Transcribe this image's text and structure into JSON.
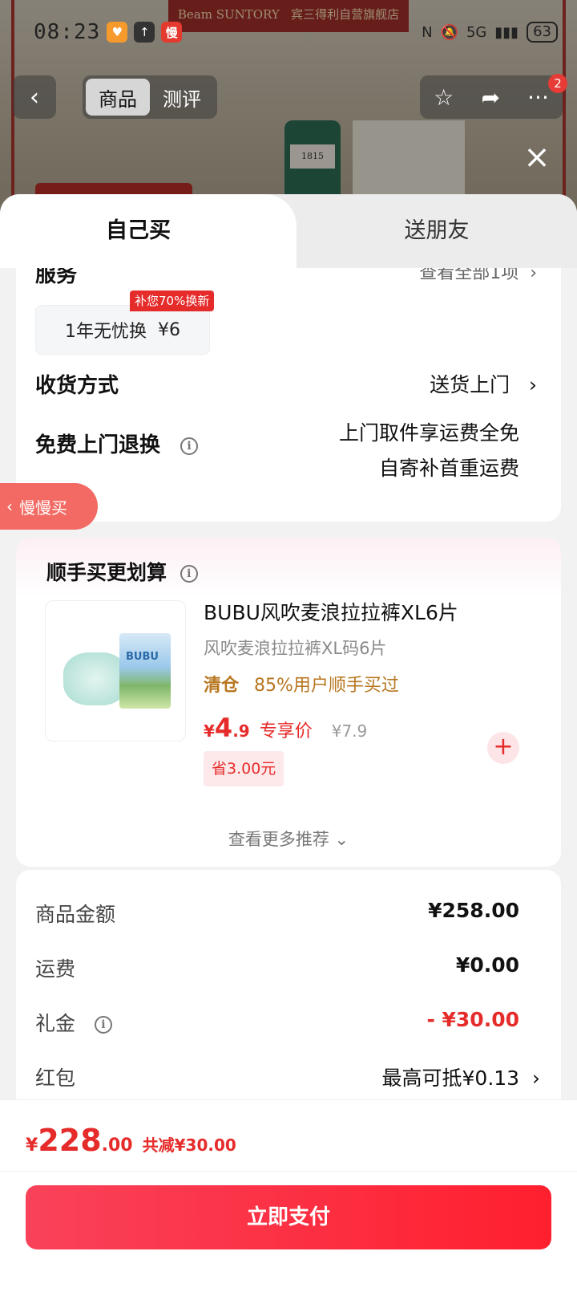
{
  "background": {
    "banner_brand": "Beam SUNTORY",
    "banner_store": "宾三得利自营旗舰店",
    "bottle_label": "1815"
  },
  "status_bar": {
    "time": "08:23",
    "app_icon_text": "慢",
    "network": "5G",
    "battery": "63"
  },
  "top_nav": {
    "tabs": [
      {
        "label": "商品",
        "active": true
      },
      {
        "label": "测评",
        "active": false
      }
    ],
    "more_badge": "2"
  },
  "sheet": {
    "tabs": [
      {
        "label": "自己买",
        "active": true
      },
      {
        "label": "送朋友",
        "active": false
      }
    ],
    "service": {
      "title": "服务",
      "more": "查看全部1项",
      "chip_label": "1年无忧换",
      "chip_price": "¥6",
      "promo": "补您70%换新"
    },
    "delivery": {
      "label": "收货方式",
      "value": "送货上门"
    },
    "returns": {
      "label": "免费上门退换",
      "line1": "上门取件享运费全免",
      "line2": "自寄补首重运费"
    },
    "slow_buy": "慢慢买",
    "recommend": {
      "title": "顺手买更划算",
      "product": {
        "name": "BUBU风吹麦浪拉拉裤XL6片",
        "subtitle": "风吹麦浪拉拉裤XL码6片",
        "clear_tag": "清仓",
        "clear_text": "85%用户顺手买过",
        "price_currency": "¥",
        "price_int": "4",
        "price_dec": ".9",
        "price_tag": "专享价",
        "original_price": "¥7.9",
        "save": "省3.00元",
        "pack_brand": "BUBU"
      },
      "more": "查看更多推荐"
    },
    "pricing": [
      {
        "label": "商品金额",
        "value": "¥258.00"
      },
      {
        "label": "运费",
        "value": "¥0.00"
      },
      {
        "label": "礼金",
        "value": "- ¥30.00"
      },
      {
        "label": "红包",
        "value": "最高可抵¥0.13"
      }
    ]
  },
  "footer": {
    "currency": "¥",
    "total_int": "228",
    "total_dec": ".00",
    "total_reduce": "共减¥30.00",
    "pay_button": "立即支付"
  },
  "colors": {
    "accent": "#e62b2b",
    "pay_button": "#ff1f2e",
    "clear_tag": "#b8761f"
  }
}
